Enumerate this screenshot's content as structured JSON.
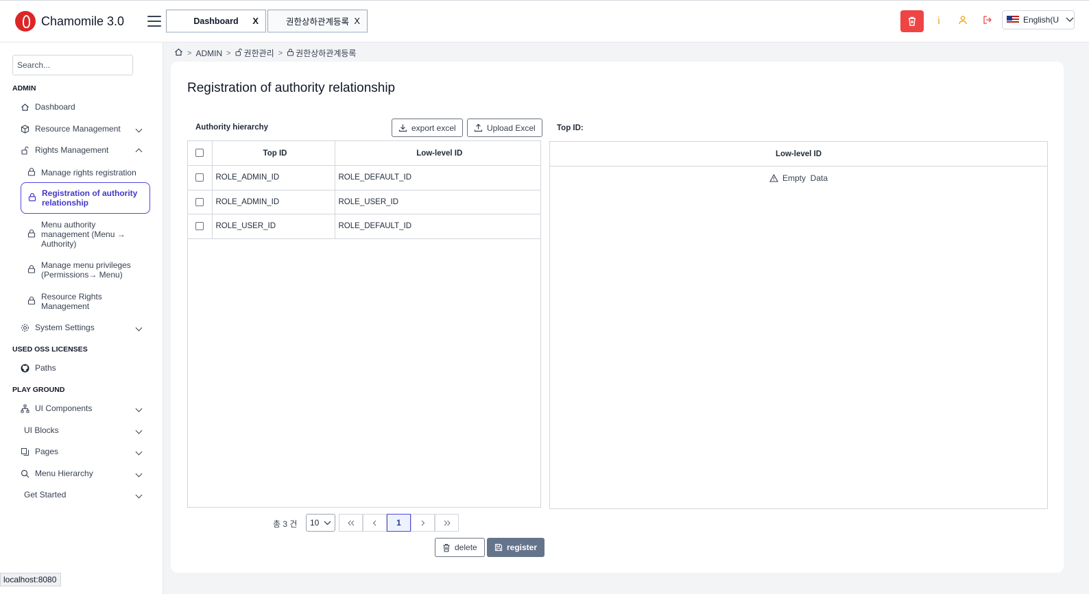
{
  "app": {
    "title": "Chamomile 3.0"
  },
  "tabs": [
    {
      "label": "Dashboard",
      "close": "X"
    },
    {
      "label": "권한상하관계등록",
      "close": "X"
    }
  ],
  "header": {
    "language": "English(U"
  },
  "sidebar": {
    "search_placeholder": "Search...",
    "sections": {
      "admin": "ADMIN",
      "oss": "USED OSS LICENSES",
      "playground": "PLAY GROUND"
    },
    "items": {
      "dashboard": "Dashboard",
      "resource_management": "Resource Management",
      "rights_management": "Rights Management",
      "manage_rights_registration": "Manage rights registration",
      "registration_authority_relationship": "Registration of authority relationship",
      "menu_authority_management": "Menu authority management (Menu → Authority)",
      "manage_menu_privileges": "Manage menu privileges (Permissions→ Menu)",
      "resource_rights_management": "Resource Rights Management",
      "system_settings": "System Settings",
      "paths": "Paths",
      "ui_components": "UI Components",
      "ui_blocks": "UI Blocks",
      "pages": "Pages",
      "menu_hierarchy": "Menu Hierarchy",
      "get_started": "Get Started"
    }
  },
  "status_bar": "localhost:8080",
  "breadcrumb": [
    "ADMIN",
    "권한관리",
    "권한상하관계등록"
  ],
  "main": {
    "title": "Registration of authority relationship",
    "left_label": "Authority hierarchy",
    "export_excel": "export excel",
    "upload_excel": "Upload Excel",
    "right_label": "Top ID:",
    "columns": {
      "top_id": "Top ID",
      "low_id": "Low-level ID"
    },
    "rows": [
      {
        "top": "ROLE_ADMIN_ID",
        "low": "ROLE_DEFAULT_ID"
      },
      {
        "top": "ROLE_ADMIN_ID",
        "low": "ROLE_USER_ID"
      },
      {
        "top": "ROLE_USER_ID",
        "low": "ROLE_DEFAULT_ID"
      }
    ],
    "right_column": "Low-level ID",
    "empty_text": "Empty  Data",
    "total": "총 3 건",
    "page_size": "10",
    "current_page": "1",
    "delete": "delete",
    "register": "register"
  },
  "colors": {
    "accent": "#4f46e5",
    "danger": "#ef4444",
    "warning": "#f59e0b",
    "register": "#64748b"
  }
}
